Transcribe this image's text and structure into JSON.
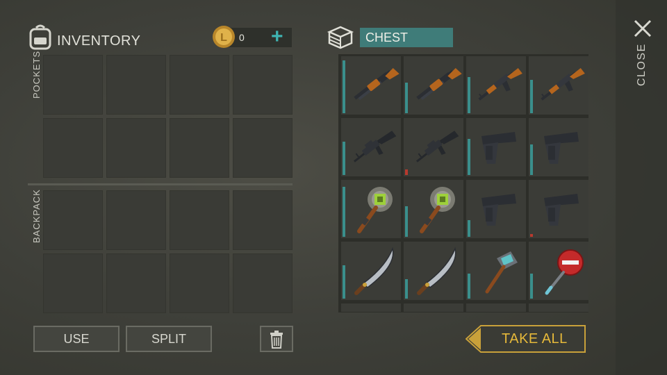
{
  "inventory": {
    "title": "INVENTORY",
    "coins": "0",
    "add_label": "+",
    "pockets_label": "POCKETS",
    "backpack_label": "BACKPACK"
  },
  "chest": {
    "title": "CHEST",
    "items": [
      {
        "icon": "pump-shotgun-icon",
        "durability": 0.95
      },
      {
        "icon": "pump-shotgun-icon",
        "durability": 0.55
      },
      {
        "icon": "assault-rifle-icon",
        "durability": 0.65
      },
      {
        "icon": "assault-rifle-icon",
        "durability": 0.6
      },
      {
        "icon": "m16-rifle-icon",
        "durability": 0.6
      },
      {
        "icon": "m16-rifle-icon",
        "durability": 0.1,
        "low": true
      },
      {
        "icon": "pistol-icon",
        "durability": 0.65
      },
      {
        "icon": "pistol-icon",
        "durability": 0.55
      },
      {
        "icon": "saw-blade-mace-icon",
        "durability": 0.9
      },
      {
        "icon": "saw-blade-mace-icon",
        "durability": 0.55
      },
      {
        "icon": "pistol-icon",
        "durability": 0.3
      },
      {
        "icon": "pistol-icon",
        "durability": 0.05,
        "low": true
      },
      {
        "icon": "machete-icon",
        "durability": 0.6
      },
      {
        "icon": "machete-icon",
        "durability": 0.35
      },
      {
        "icon": "sledgehammer-icon",
        "durability": 0.45
      },
      {
        "icon": "stop-sign-axe-icon",
        "durability": 0.45
      }
    ]
  },
  "close_label": "CLOSE",
  "buttons": {
    "use": "USE",
    "split": "SPLIT",
    "take_all": "TAKE ALL"
  },
  "colors": {
    "accent_teal": "#3fb3b1",
    "chest_title_bg": "#3f7c79",
    "take_all_gold": "#e6b93a"
  }
}
